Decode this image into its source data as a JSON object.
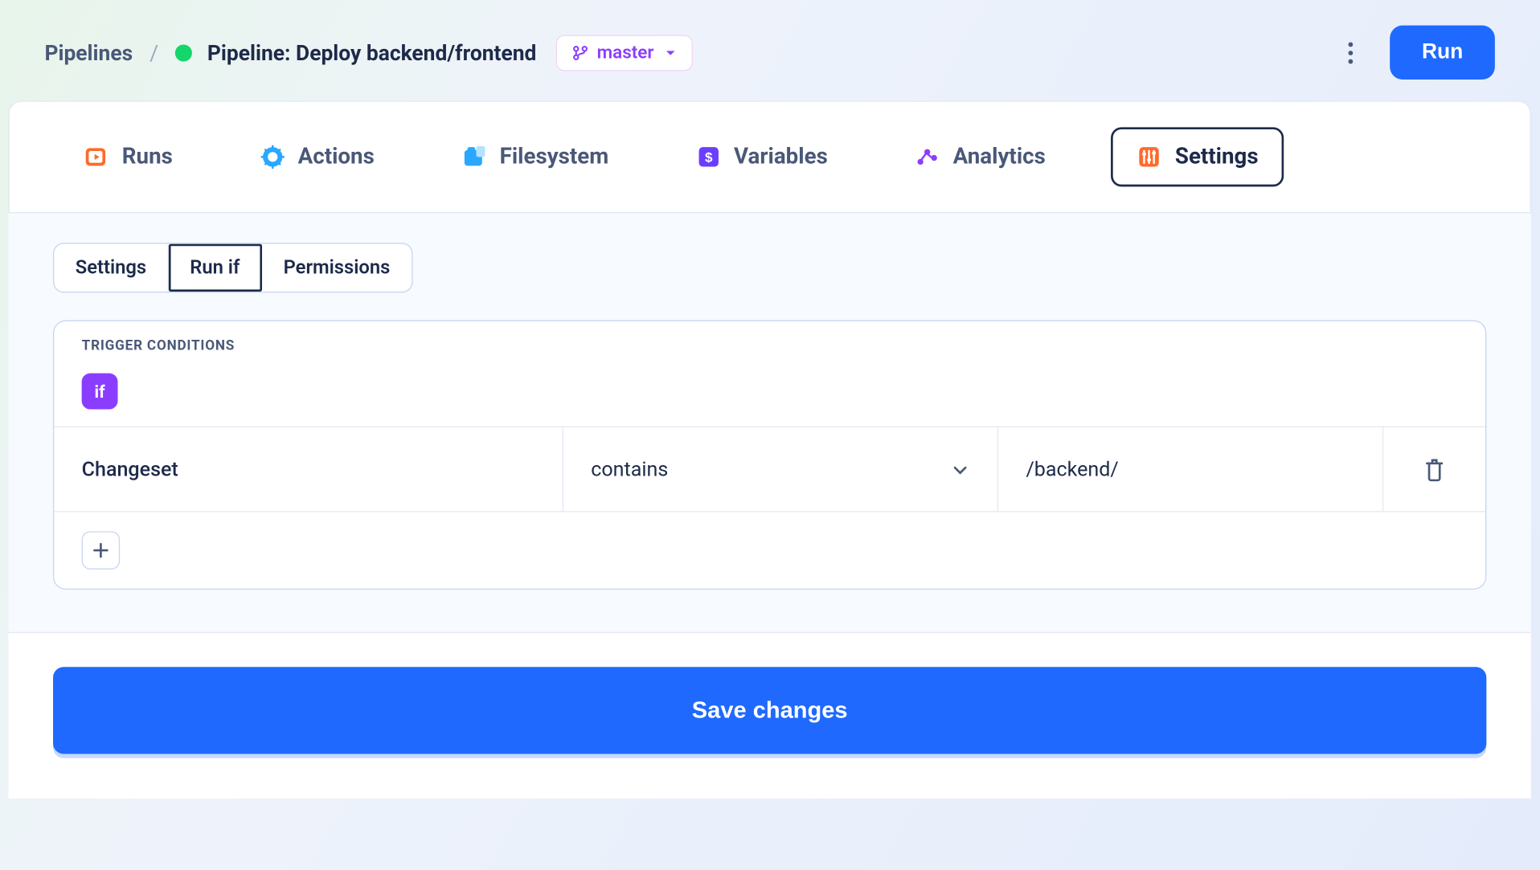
{
  "header": {
    "breadcrumb_root": "Pipelines",
    "breadcrumb_sep": "/",
    "pipeline_title": "Pipeline: Deploy backend/frontend",
    "branch": "master",
    "run_label": "Run"
  },
  "main_tabs": {
    "runs": "Runs",
    "actions": "Actions",
    "filesystem": "Filesystem",
    "variables": "Variables",
    "analytics": "Analytics",
    "settings": "Settings",
    "active": "settings"
  },
  "sub_tabs": {
    "settings": "Settings",
    "run_if": "Run if",
    "permissions": "Permissions",
    "active": "run_if"
  },
  "trigger": {
    "section_title": "TRIGGER CONDITIONS",
    "if_label": "if",
    "condition": {
      "field": "Changeset",
      "operator": "contains",
      "value": "/backend/"
    }
  },
  "footer": {
    "save_label": "Save changes"
  }
}
